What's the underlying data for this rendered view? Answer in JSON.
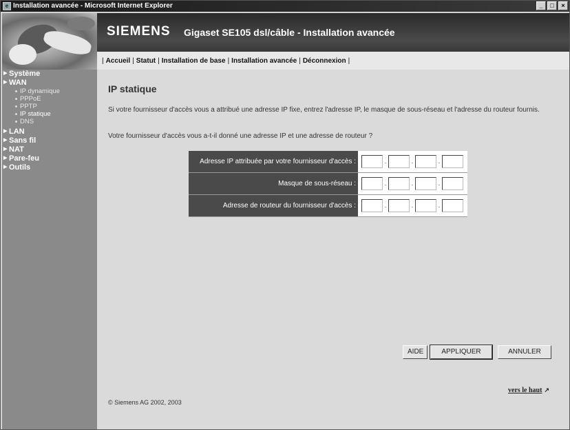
{
  "window": {
    "title": "Installation avancée - Microsoft Internet Explorer",
    "buttons": {
      "minimize": "_",
      "maximize": "□",
      "close": "×"
    }
  },
  "header": {
    "brand": "SIEMENS",
    "title": "Gigaset SE105 dsl/câble  -  Installation avancée"
  },
  "nav": {
    "items": [
      {
        "label": "Accueil"
      },
      {
        "label": "Statut"
      },
      {
        "label": "Installation de base"
      },
      {
        "label": "Installation avancée"
      },
      {
        "label": "Déconnexion"
      }
    ]
  },
  "sidebar": {
    "items": [
      {
        "label": "Système"
      },
      {
        "label": "WAN"
      },
      {
        "label": "LAN"
      },
      {
        "label": "Sans fil"
      },
      {
        "label": "NAT"
      },
      {
        "label": "Pare-feu"
      },
      {
        "label": "Outils"
      }
    ],
    "wan_sub": [
      {
        "label": "IP dynamique"
      },
      {
        "label": "PPPoE"
      },
      {
        "label": "PPTP"
      },
      {
        "label": "IP statique"
      },
      {
        "label": "DNS"
      }
    ]
  },
  "main": {
    "title": "IP statique",
    "description": "Si votre fournisseur d'accès vous a attribué une adresse IP fixe, entrez l'adresse IP, le masque de sous-réseau et l'adresse du routeur fournis.",
    "question": "Votre fournisseur d'accès vous a-t-il donné une adresse IP et une adresse de routeur ?",
    "fields": [
      {
        "label": "Adresse IP attribuée par votre fournisseur d'accès :",
        "values": [
          "",
          "",
          "",
          ""
        ]
      },
      {
        "label": "Masque de sous-réseau :",
        "values": [
          "",
          "",
          "",
          ""
        ]
      },
      {
        "label": "Adresse de routeur du fournisseur d'accès :",
        "values": [
          "",
          "",
          "",
          ""
        ]
      }
    ],
    "buttons": {
      "help": "AIDE",
      "apply": "APPLIQUER",
      "cancel": "ANNULER"
    },
    "top_link": "vers le haut",
    "copyright": "© Siemens AG 2002, 2003"
  }
}
